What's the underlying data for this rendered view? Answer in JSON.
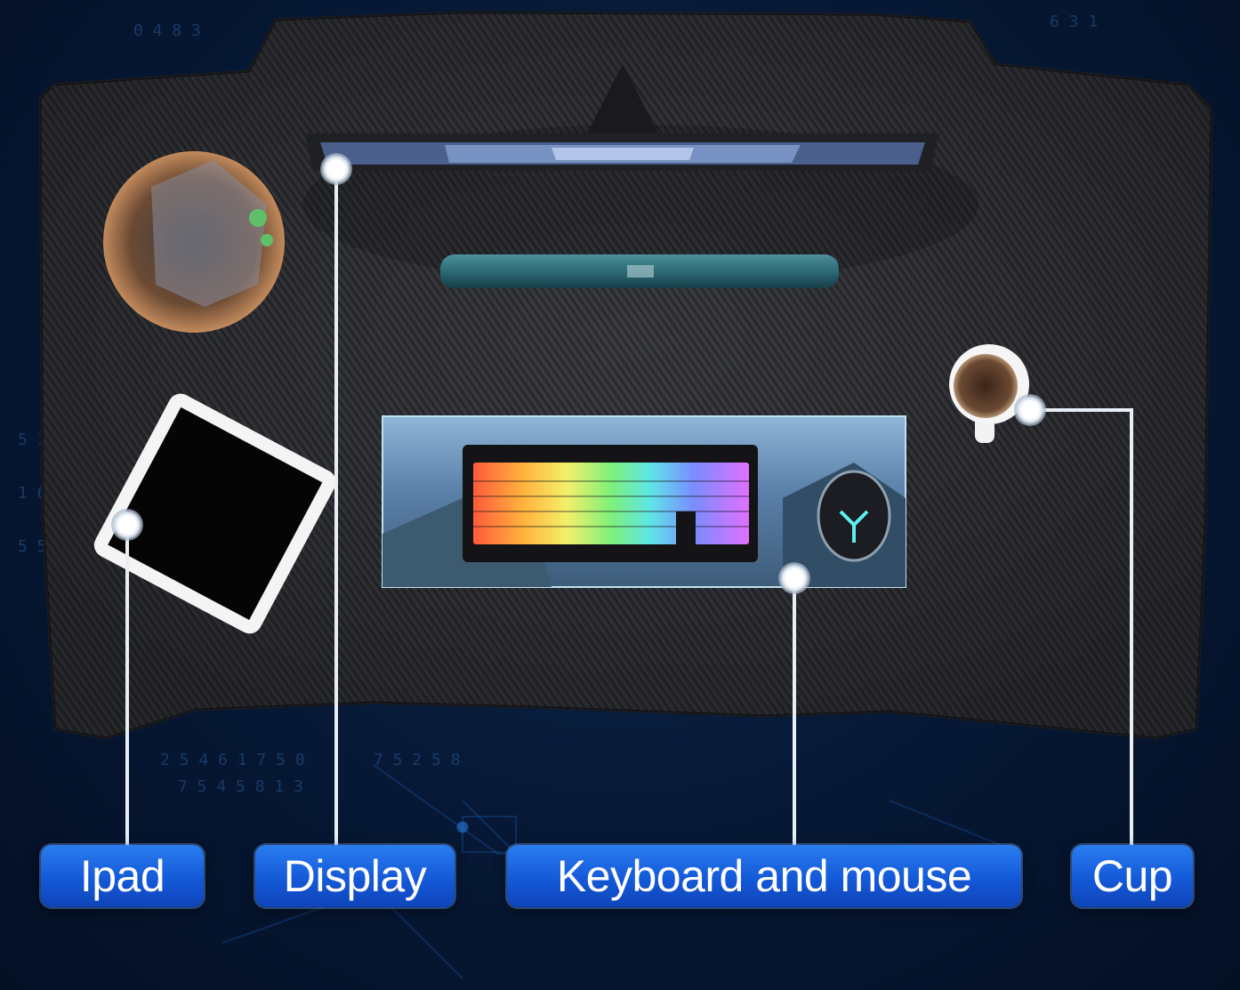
{
  "labels": {
    "ipad": "Ipad",
    "display": "Display",
    "keyboard_mouse": "Keyboard and mouse",
    "cup": "Cup"
  },
  "colors": {
    "background": "#071a38",
    "desk": "#2a2b2f",
    "label_fill": "#1a62e0",
    "callout_line": "#e8eef6"
  }
}
